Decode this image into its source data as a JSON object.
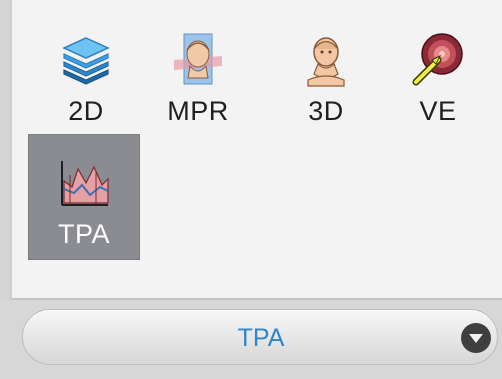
{
  "modes": [
    {
      "label": "2D",
      "icon": "stacked-layers-icon",
      "selected": false
    },
    {
      "label": "MPR",
      "icon": "head-with-planes-icon",
      "selected": false
    },
    {
      "label": "3D",
      "icon": "3d-head-icon",
      "selected": false
    },
    {
      "label": "VE",
      "icon": "virtual-endoscopy-icon",
      "selected": false
    },
    {
      "label": "TPA",
      "icon": "tpa-chart-icon",
      "selected": true
    }
  ],
  "mode_selector": {
    "value": "TPA",
    "icon": "chevron-down-icon"
  },
  "colors": {
    "selected_bg": "#8a8c91",
    "selector_text": "#2f86c9",
    "panel_bg": "#f3f3f3"
  }
}
